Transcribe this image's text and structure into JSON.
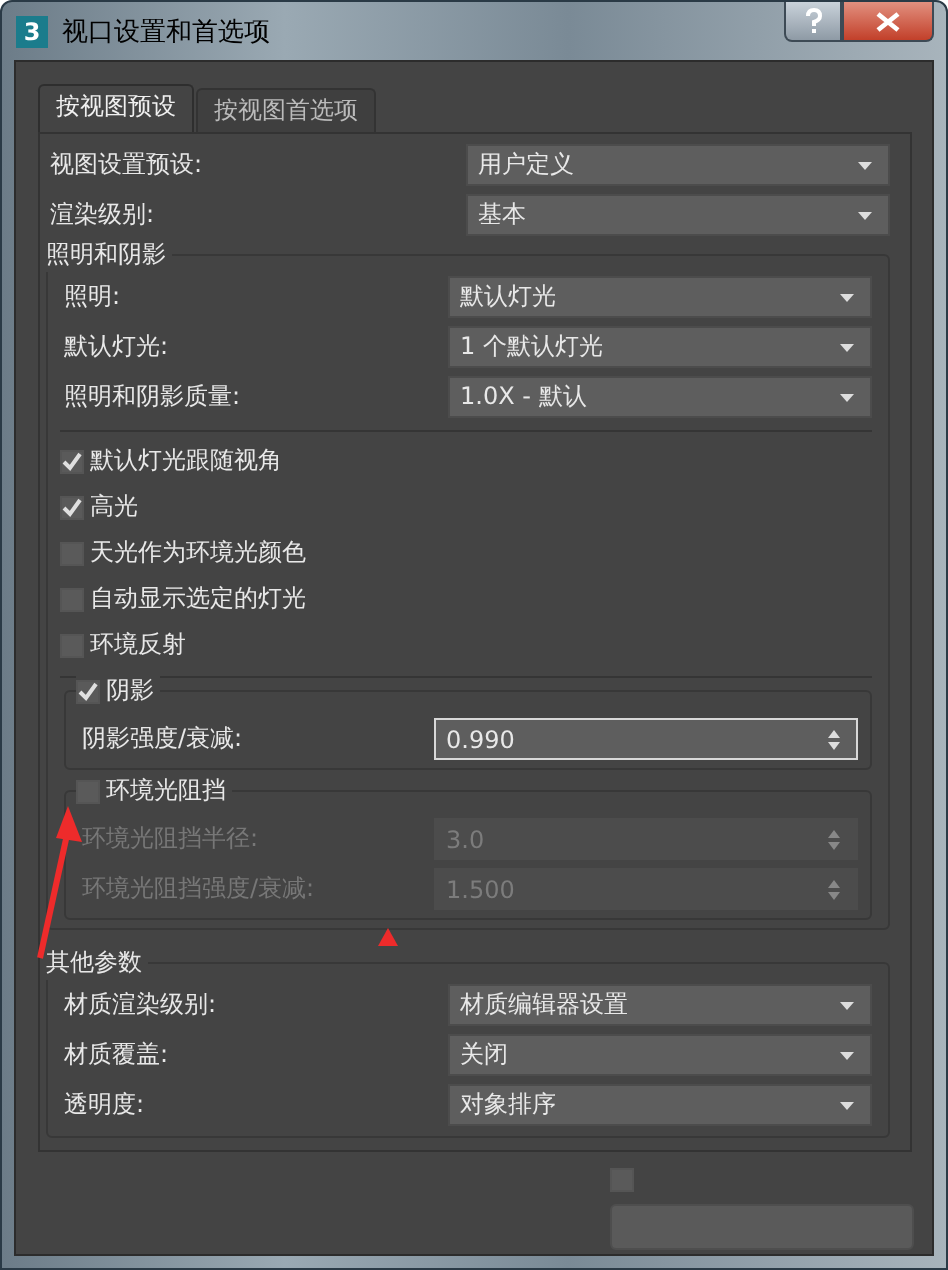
{
  "window": {
    "app_icon": "3",
    "title": "视口设置和首选项"
  },
  "tabs": [
    {
      "label": "按视图预设",
      "selected": true
    },
    {
      "label": "按视图首选项",
      "selected": false
    }
  ],
  "settings": [
    {
      "kind": "dropdown",
      "label": "视图设置预设:",
      "value": "用户定义"
    },
    {
      "kind": "dropdown",
      "label": "渲染级别:",
      "value": "基本"
    }
  ],
  "lighting_group": {
    "title": "照明和阴影",
    "rows": [
      {
        "kind": "dropdown",
        "label": "照明:",
        "value": "默认灯光"
      },
      {
        "kind": "dropdown",
        "label": "默认灯光:",
        "value": "1 个默认灯光"
      },
      {
        "kind": "dropdown",
        "label": "照明和阴影质量:",
        "value": "1.0X - 默认"
      }
    ],
    "checkboxes": [
      {
        "label": "默认灯光跟随视角",
        "checked": true
      },
      {
        "label": "高光",
        "checked": true
      },
      {
        "label": "天光作为环境光颜色",
        "checked": false
      },
      {
        "label": "自动显示选定的灯光",
        "checked": false
      },
      {
        "label": "环境反射",
        "checked": false
      }
    ],
    "shadow": {
      "title": "阴影",
      "checked": true,
      "rows": [
        {
          "kind": "spinner",
          "label": "阴影强度/衰减:",
          "value": "0.990",
          "focused": true,
          "disabled": false
        }
      ]
    },
    "ambient_occlusion": {
      "title": "环境光阻挡",
      "checked": false,
      "rows": [
        {
          "kind": "spinner",
          "label": "环境光阻挡半径:",
          "value": "3.0",
          "focused": false,
          "disabled": true
        },
        {
          "kind": "spinner",
          "label": "环境光阻挡强度/衰减:",
          "value": "1.500",
          "focused": false,
          "disabled": true
        }
      ]
    }
  },
  "other_group": {
    "title": "其他参数",
    "rows": [
      {
        "kind": "dropdown",
        "label": "材质渲染级别:",
        "value": "材质编辑器设置"
      },
      {
        "kind": "dropdown",
        "label": "材质覆盖:",
        "value": "关闭"
      },
      {
        "kind": "dropdown",
        "label": "透明度:",
        "value": "对象排序"
      }
    ]
  },
  "footer": {
    "checkbox": {
      "checked": false
    }
  }
}
